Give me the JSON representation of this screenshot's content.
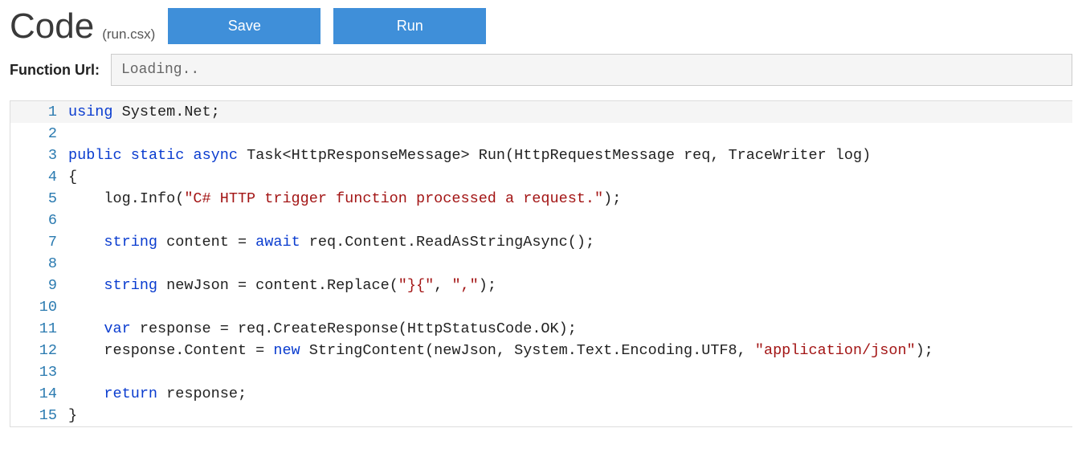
{
  "header": {
    "title": "Code",
    "subtitle": "(run.csx)",
    "save_label": "Save",
    "run_label": "Run"
  },
  "url_section": {
    "label": "Function Url:",
    "value": "Loading.."
  },
  "editor": {
    "lines": [
      {
        "n": "1",
        "current": true,
        "segs": [
          {
            "t": "using",
            "c": "kw"
          },
          {
            "t": " System.Net;"
          }
        ]
      },
      {
        "n": "2",
        "segs": []
      },
      {
        "n": "3",
        "segs": [
          {
            "t": "public",
            "c": "kw"
          },
          {
            "t": " "
          },
          {
            "t": "static",
            "c": "kw"
          },
          {
            "t": " "
          },
          {
            "t": "async",
            "c": "kw"
          },
          {
            "t": " Task<HttpResponseMessage> Run(HttpRequestMessage req, TraceWriter log)"
          }
        ]
      },
      {
        "n": "4",
        "segs": [
          {
            "t": "{"
          }
        ]
      },
      {
        "n": "5",
        "segs": [
          {
            "t": "    log.Info("
          },
          {
            "t": "\"C# HTTP trigger function processed a request.\"",
            "c": "str"
          },
          {
            "t": ");"
          }
        ]
      },
      {
        "n": "6",
        "segs": []
      },
      {
        "n": "7",
        "segs": [
          {
            "t": "    "
          },
          {
            "t": "string",
            "c": "kw"
          },
          {
            "t": " content = "
          },
          {
            "t": "await",
            "c": "kw"
          },
          {
            "t": " req.Content.ReadAsStringAsync();"
          }
        ]
      },
      {
        "n": "8",
        "segs": []
      },
      {
        "n": "9",
        "segs": [
          {
            "t": "    "
          },
          {
            "t": "string",
            "c": "kw"
          },
          {
            "t": " newJson = content.Replace("
          },
          {
            "t": "\"}{\"",
            "c": "str"
          },
          {
            "t": ", "
          },
          {
            "t": "\",\"",
            "c": "str"
          },
          {
            "t": ");"
          }
        ]
      },
      {
        "n": "10",
        "segs": []
      },
      {
        "n": "11",
        "segs": [
          {
            "t": "    "
          },
          {
            "t": "var",
            "c": "kw"
          },
          {
            "t": " response = req.CreateResponse(HttpStatusCode.OK);"
          }
        ]
      },
      {
        "n": "12",
        "segs": [
          {
            "t": "    response.Content = "
          },
          {
            "t": "new",
            "c": "kw"
          },
          {
            "t": " StringContent(newJson, System.Text.Encoding.UTF8, "
          },
          {
            "t": "\"application/json\"",
            "c": "str"
          },
          {
            "t": ");"
          }
        ]
      },
      {
        "n": "13",
        "segs": []
      },
      {
        "n": "14",
        "segs": [
          {
            "t": "    "
          },
          {
            "t": "return",
            "c": "kw"
          },
          {
            "t": " response;"
          }
        ]
      },
      {
        "n": "15",
        "segs": [
          {
            "t": "}"
          }
        ]
      }
    ]
  }
}
